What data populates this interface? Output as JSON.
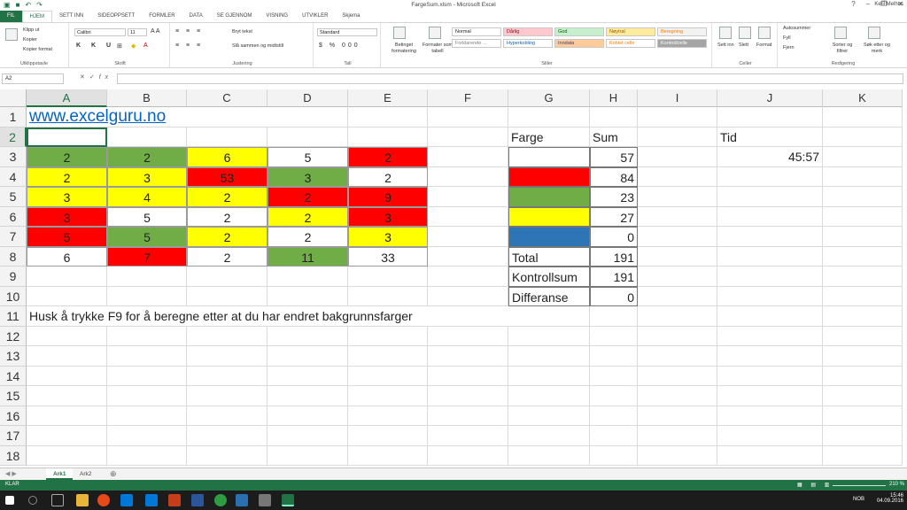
{
  "window": {
    "title": "FargeSum.xlsm - Microsoft Excel",
    "user": "Ketil Melhus"
  },
  "ribbon_tabs": [
    "FIL",
    "HJEM",
    "SETT INN",
    "SIDEOPPSETT",
    "FORMLER",
    "DATA",
    "SE GJENNOM",
    "VISNING",
    "UTVIKLER",
    "Skjema"
  ],
  "ribbon": {
    "clipboard": {
      "cut": "Klipp ut",
      "copy": "Kopier",
      "format_painter": "Kopier format",
      "group": "Utklippstavle"
    },
    "font": {
      "name": "Calibri",
      "size": "11",
      "group": "Skrift"
    },
    "alignment": {
      "wrap": "Bryt tekst",
      "merge": "Slå sammen og midtstill",
      "group": "Justering"
    },
    "number": {
      "format": "Standard",
      "group": "Tall"
    },
    "styles": {
      "conditional": "Betinget formatering",
      "as_table": "Formater som tabell",
      "cells": [
        {
          "label": "Normal",
          "bg": "#ffffff",
          "fg": "#222222"
        },
        {
          "label": "Dårlig",
          "bg": "#ffc7ce",
          "fg": "#9c0006"
        },
        {
          "label": "God",
          "bg": "#c6efce",
          "fg": "#006100"
        },
        {
          "label": "Nøytral",
          "bg": "#ffeb9c",
          "fg": "#9c5700"
        },
        {
          "label": "Beregning",
          "bg": "#f2f2f2",
          "fg": "#fa7d00"
        },
        {
          "label": "Forklarende ...",
          "bg": "#ffffff",
          "fg": "#7f7f7f"
        },
        {
          "label": "Hyperkobling",
          "bg": "#ffffff",
          "fg": "#0563c1"
        },
        {
          "label": "Inndata",
          "bg": "#ffcc99",
          "fg": "#3f3f76"
        },
        {
          "label": "Koblet celle",
          "bg": "#ffffff",
          "fg": "#fa7d00"
        },
        {
          "label": "Kontrollcelle",
          "bg": "#a5a5a5",
          "fg": "#ffffff"
        }
      ],
      "group": "Stiler"
    },
    "cells": {
      "insert": "Sett inn",
      "delete": "Slett",
      "format": "Format",
      "group": "Celler"
    },
    "editing": {
      "autosum": "Autosummer",
      "fill": "Fyll",
      "clear": "Fjern",
      "sort": "Sorter og filtrer",
      "find": "Søk etter og merk",
      "group": "Redigering"
    }
  },
  "formula_bar": {
    "name_box": "A2",
    "fx": "fx",
    "value": ""
  },
  "columns": [
    "A",
    "B",
    "C",
    "D",
    "E",
    "F",
    "G",
    "H",
    "I",
    "J",
    "K"
  ],
  "rows": [
    "1",
    "2",
    "3",
    "4",
    "5",
    "6",
    "7",
    "8",
    "9",
    "10",
    "11",
    "12",
    "13",
    "14",
    "15",
    "16",
    "17",
    "18"
  ],
  "colors": {
    "green": "#70ad47",
    "red": "#ff0000",
    "yellow": "#ffff00",
    "blue": "#2e75b6",
    "white": "#ffffff",
    "excel_green": "#217346"
  },
  "sheet": {
    "link": "www.excelguru.no",
    "note": "Husk å trykke F9 for å beregne etter at du har endret bakgrunnsfarger",
    "grid": [
      [
        {
          "v": "2",
          "c": "green"
        },
        {
          "v": "2",
          "c": "green"
        },
        {
          "v": "6",
          "c": "yellow"
        },
        {
          "v": "5",
          "c": "white"
        },
        {
          "v": "2",
          "c": "red"
        }
      ],
      [
        {
          "v": "2",
          "c": "yellow"
        },
        {
          "v": "3",
          "c": "yellow"
        },
        {
          "v": "53",
          "c": "red"
        },
        {
          "v": "3",
          "c": "green"
        },
        {
          "v": "2",
          "c": "white"
        }
      ],
      [
        {
          "v": "3",
          "c": "yellow"
        },
        {
          "v": "4",
          "c": "yellow"
        },
        {
          "v": "2",
          "c": "yellow"
        },
        {
          "v": "2",
          "c": "red"
        },
        {
          "v": "9",
          "c": "red"
        }
      ],
      [
        {
          "v": "3",
          "c": "red"
        },
        {
          "v": "5",
          "c": "white"
        },
        {
          "v": "2",
          "c": "white"
        },
        {
          "v": "2",
          "c": "yellow"
        },
        {
          "v": "3",
          "c": "red"
        }
      ],
      [
        {
          "v": "5",
          "c": "red"
        },
        {
          "v": "5",
          "c": "green"
        },
        {
          "v": "2",
          "c": "yellow"
        },
        {
          "v": "2",
          "c": "white"
        },
        {
          "v": "3",
          "c": "yellow"
        }
      ],
      [
        {
          "v": "6",
          "c": "white"
        },
        {
          "v": "7",
          "c": "red"
        },
        {
          "v": "2",
          "c": "white"
        },
        {
          "v": "11",
          "c": "green"
        },
        {
          "v": "33",
          "c": "white"
        }
      ]
    ],
    "summary_header": {
      "farge": "Farge",
      "sum": "Sum",
      "tid": "Tid"
    },
    "summary_rows": [
      {
        "color": "white",
        "sum": "57"
      },
      {
        "color": "red",
        "sum": "84"
      },
      {
        "color": "green",
        "sum": "23"
      },
      {
        "color": "yellow",
        "sum": "27"
      },
      {
        "color": "blue",
        "sum": "0"
      }
    ],
    "totals": [
      {
        "label": "Total",
        "value": "191"
      },
      {
        "label": "Kontrollsum",
        "value": "191"
      },
      {
        "label": "Differanse",
        "value": "0"
      }
    ],
    "tid_value": "45:57"
  },
  "sheet_tabs": [
    "Ark1",
    "Ark2"
  ],
  "status": {
    "mode": "KLAR",
    "zoom": "210 %"
  },
  "taskbar": {
    "lang": "NOB",
    "time": "15:46",
    "date": "04.09.2016"
  }
}
